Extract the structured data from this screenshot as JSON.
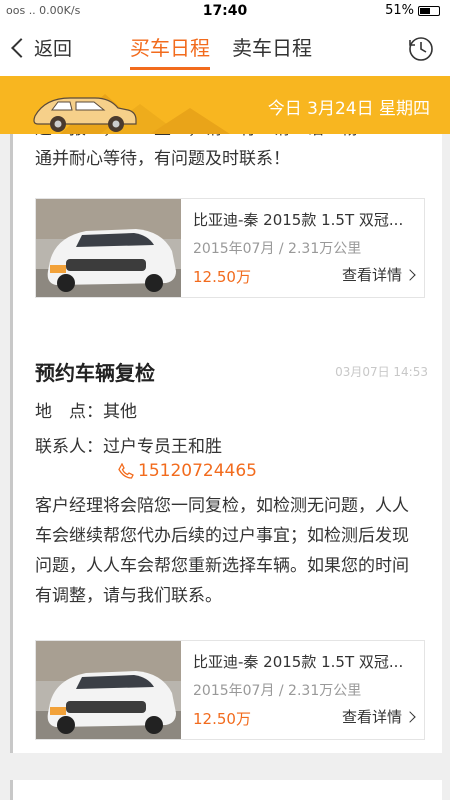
{
  "status_bar": {
    "left_text": "oos .. 0.00K/s",
    "time": "17:40",
    "battery": "51%"
  },
  "nav": {
    "back_label": "返回",
    "tabs": [
      "买车日程",
      "卖车日程"
    ]
  },
  "banner": {
    "date": "今日 3月24日 星期四"
  },
  "card1": {
    "message_lines": [
      "进…报…，……里…，请…有…请…话…畅",
      "通并耐心等待，有问题及时联系！"
    ],
    "car": {
      "title": "比亚迪-秦 2015款 1.5T 双冠...",
      "meta": "2015年07月 / 2.31万公里",
      "price": "12.50万",
      "detail": "查看详情"
    }
  },
  "card2": {
    "title": "预约车辆复检",
    "time": "03月07日 14:53",
    "location_label": "地　点：",
    "location_value": "其他",
    "contact_label": "联系人：",
    "contact_value": "过户专员王和胜",
    "phone": "15120724465",
    "message": "客户经理将会陪您一同复检，如检测无问题，人人车会继续帮您代办后续的过户事宜；如检测后发现问题，人人车会帮您重新选择车辆。如果您的时间有调整，请与我们联系。",
    "car": {
      "title": "比亚迪-秦 2015款 1.5T 双冠...",
      "meta": "2015年07月 / 2.31万公里",
      "price": "12.50万",
      "detail": "查看详情"
    }
  },
  "colors": {
    "accent": "#f26b1d",
    "banner": "#f8b620"
  }
}
